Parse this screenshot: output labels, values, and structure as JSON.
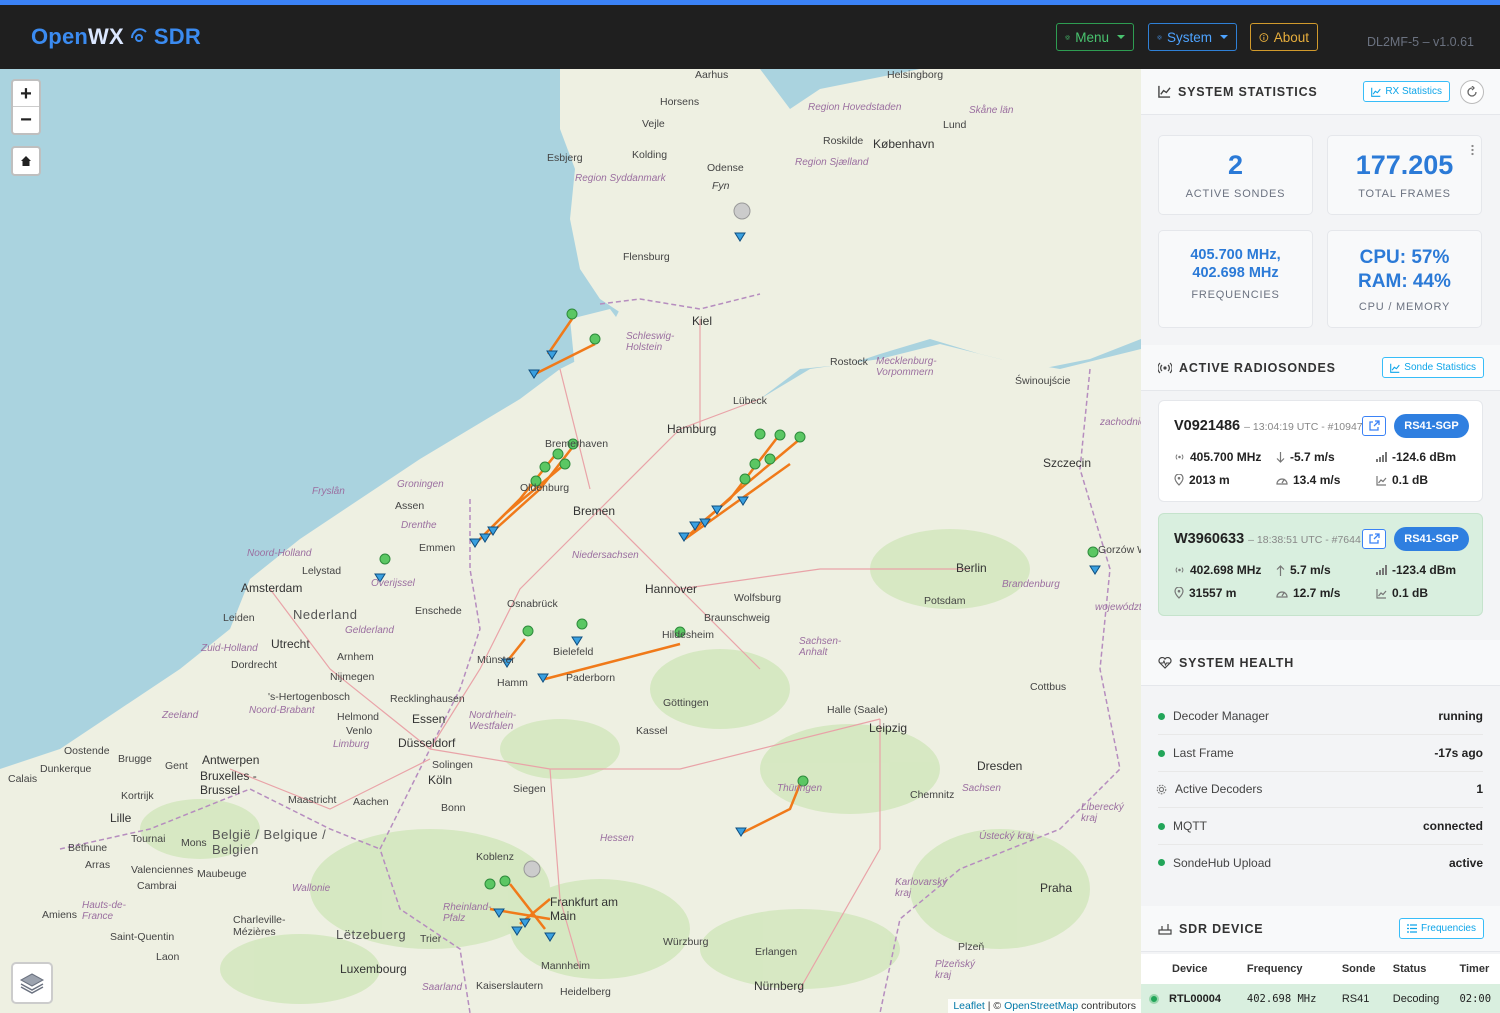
{
  "header": {
    "brand_a": "Open",
    "brand_b": "WX",
    "brand_c": "SDR",
    "menu_label": "Menu",
    "system_label": "System",
    "about_label": "About",
    "version": "DL2MF-5 – v1.0.61",
    "accent": "#3b82f6"
  },
  "map": {
    "zoom_in": "+",
    "zoom_out": "−",
    "attribution_leaflet": "Leaflet",
    "attribution_sep": " | © ",
    "attribution_osm": "OpenStreetMap",
    "attribution_tail": " contributors",
    "labels": {
      "aarhus": "Aarhus",
      "helsingborg": "Helsingborg",
      "horsens": "Horsens",
      "vejle": "Vejle",
      "region_hovedstaden": "Region Hovedstaden",
      "skane": "Skåne län",
      "lund": "Lund",
      "roskilde": "Roskilde",
      "kobenhavn": "København",
      "esbjerg": "Esbjerg",
      "kolding": "Kolding",
      "odense": "Odense",
      "region_sjaelland": "Region Sjælland",
      "region_syddanmark": "Region Syddanmark",
      "fyn": "Fyn",
      "flensburg": "Flensburg",
      "kiel": "Kiel",
      "schleswig_holstein": "Schleswig-Holstein",
      "rostock": "Rostock",
      "mecklenburg": "Mecklenburg-Vorpommern",
      "swinoujscie": "Świnoujście",
      "lubeck": "Lübeck",
      "hamburg": "Hamburg",
      "szczecin": "Szczecin",
      "bremerhaven": "Bremerhaven",
      "groningen": "Groningen",
      "fryslan": "Fryslân",
      "assen": "Assen",
      "drenthe": "Drenthe",
      "oldenburg": "Oldenburg",
      "bremen": "Bremen",
      "emmen": "Emmen",
      "niedersachsen": "Niedersachsen",
      "noord_holland": "Noord-Holland",
      "lelystad": "Lelystad",
      "amsterdam": "Amsterdam",
      "nederland": "Nederland",
      "ijssel": "Overijssel",
      "berlin": "Berlin",
      "brandenburg": "Brandenburg",
      "potsdam": "Potsdam",
      "hannover": "Hannover",
      "wolfsburg": "Wolfsburg",
      "osnabruck": "Osnabrück",
      "enschede": "Enschede",
      "leiden": "Leiden",
      "utrecht": "Utrecht",
      "gelderland": "Gelderland",
      "braunschweig": "Braunschweig",
      "hildesheim": "Hildesheim",
      "sachsen_anhalt": "Sachsen-Anhalt",
      "zuid_holland": "Zuid-Holland",
      "arnhem": "Arnhem",
      "bielefeld": "Bielefeld",
      "munster": "Münster",
      "dordrecht": "Dordrecht",
      "nijmegen": "Nijmegen",
      "hamm": "Hamm",
      "paderborn": "Paderborn",
      "hertogenbosch": "'s-Hertogenbosch",
      "noord_brabant": "Noord-Brabant",
      "recklinghausen": "Recklinghausen",
      "gottingen": "Göttingen",
      "cottbus": "Cottbus",
      "zeeland": "Zeeland",
      "helmond": "Helmond",
      "essen": "Essen",
      "nrw": "Nordrhein-Westfalen",
      "halle": "Halle (Saale)",
      "leipzig": "Leipzig",
      "venlo": "Venlo",
      "dusseldorf": "Düsseldorf",
      "kassel": "Kassel",
      "limburg": "Limburg",
      "oostende": "Oostende",
      "brugge": "Brugge",
      "gent": "Gent",
      "antwerpen": "Antwerpen",
      "dresden": "Dresden",
      "dunkerque": "Dunkerque",
      "bruxelles": "Bruxelles - Brussel",
      "koln": "Köln",
      "solingen": "Solingen",
      "siegen": "Siegen",
      "thuringen": "Thüringen",
      "sachsen": "Sachsen",
      "calais": "Calais",
      "kortrijk": "Kortrijk",
      "maastricht": "Maastricht",
      "aachen": "Aachen",
      "bonn": "Bonn",
      "chemnitz": "Chemnitz",
      "lille": "Lille",
      "belgie": "België / Belgique / Belgien",
      "hessen": "Hessen",
      "ustecky": "Ústecký kraj",
      "liberecky": "Liberecký kraj",
      "tournai": "Tournai",
      "mons": "Mons",
      "bethune": "Béthune",
      "koblenz": "Koblenz",
      "arras": "Arras",
      "valenciennes": "Valenciennes",
      "maubeuge": "Maubeuge",
      "cambrai": "Cambrai",
      "wallonie": "Wallonie",
      "karlovarsky": "Karlovarský kraj",
      "praha": "Praha",
      "frankfurt": "Frankfurt am Main",
      "hauts_de_france": "Hauts-de-France",
      "rheinland_pfalz": "Rheinland-Pfalz",
      "amiens": "Amiens",
      "charleville": "Charleville-Mézières",
      "letzebuerg": "Lëtzebuerg",
      "trier": "Trier",
      "wurzburg": "Würzburg",
      "saint_quentin": "Saint-Quentin",
      "laon": "Laon",
      "plzen": "Plzeň",
      "plzensky": "Plzeňský kraj",
      "luxembourg": "Luxembourg",
      "mannheim": "Mannheim",
      "erlangen": "Erlangen",
      "saarland": "Saarland",
      "kaiserslautern": "Kaiserslautern",
      "heidelberg": "Heidelberg",
      "nurnberg": "Nürnberg",
      "gorzow": "Gorzów Wielkopolski",
      "wojewodztwo": "województwo lubuskie",
      "zachodnio": "zachodniopomorskie"
    }
  },
  "stats": {
    "title": "SYSTEM STATISTICS",
    "rx_button": "RX Statistics",
    "active_sondes_value": "2",
    "active_sondes_label": "ACTIVE SONDES",
    "total_frames_value": "177.205",
    "total_frames_label": "TOTAL FRAMES",
    "freq_line1": "405.700 MHz,",
    "freq_line2": "402.698 MHz",
    "freq_label": "FREQUENCIES",
    "cpu_value": "CPU: 57%",
    "ram_value": "RAM: 44%",
    "cpu_label": "CPU / MEMORY"
  },
  "radiosondes": {
    "title": "ACTIVE RADIOSONDES",
    "stats_button": "Sonde Statistics",
    "items": [
      {
        "id": "V0921486",
        "meta": "– 13:04:19 UTC - #10947",
        "type": "RS41-SGP",
        "freq": "405.700 MHz",
        "vspeed": "-5.7 m/s",
        "rssi": "-124.6 dBm",
        "alt": "2013 m",
        "hspeed": "13.4 m/s",
        "snr": "0.1 dB"
      },
      {
        "id": "W3960633",
        "meta": "– 18:38:51 UTC - #7644",
        "type": "RS41-SGP",
        "freq": "402.698 MHz",
        "vspeed": "5.7 m/s",
        "rssi": "-123.4 dBm",
        "alt": "31557 m",
        "hspeed": "12.7 m/s",
        "snr": "0.1 dB"
      }
    ]
  },
  "health": {
    "title": "SYSTEM HEALTH",
    "rows": [
      {
        "label": "Decoder Manager",
        "value": "running"
      },
      {
        "label": "Last Frame",
        "value": "-17s ago"
      },
      {
        "label": "Active Decoders",
        "value": "1"
      },
      {
        "label": "MQTT",
        "value": "connected"
      },
      {
        "label": "SondeHub Upload",
        "value": "active"
      }
    ],
    "ok_color": "#22a559"
  },
  "sdr": {
    "title": "SDR DEVICE",
    "freq_button": "Frequencies",
    "columns": [
      "Device",
      "Frequency",
      "Sonde",
      "Status",
      "Timer"
    ],
    "row": [
      "RTL00004",
      "402.698 MHz",
      "RS41",
      "Decoding",
      "02:00"
    ]
  },
  "icons": [
    "globe-wave-icon",
    "gear-icon",
    "info-icon",
    "home-icon",
    "layers-icon",
    "chart-icon",
    "refresh-icon",
    "antenna-icon",
    "heart-pulse-icon",
    "router-icon",
    "external-link-icon",
    "arrow-down-icon",
    "arrow-up-icon",
    "signal-icon",
    "pin-icon",
    "gauge-icon",
    "trend-icon",
    "list-icon"
  ]
}
